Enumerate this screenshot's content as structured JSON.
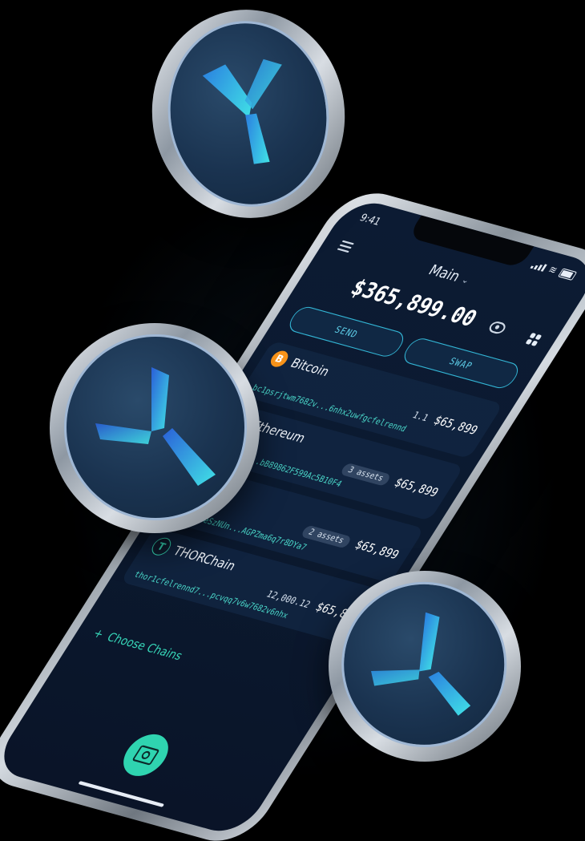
{
  "status_bar": {
    "time": "9:41"
  },
  "header": {
    "vault_name": "Main"
  },
  "portfolio": {
    "balance": "$365,899.00"
  },
  "actions": {
    "send_label": "SEND",
    "swap_label": "SWAP"
  },
  "chains": [
    {
      "name": "Bitcoin",
      "logo": "B",
      "amount": "1.1",
      "value": "$65,899",
      "address": "bc1psrjtwm7682v...6nhx2uwfgcfelrennd",
      "assets": ""
    },
    {
      "name": "Ethereum",
      "logo": "E",
      "amount": "",
      "value": "$65,899",
      "address": "0x0a4242...bB89862F599Ac5B10F4",
      "assets": "3 assets"
    },
    {
      "name": "",
      "logo": "",
      "amount": "",
      "value": "$65,899",
      "address": "...2bKieSzNUn...AGPZma6q7r8DYa7",
      "assets": "2 assets"
    },
    {
      "name": "THORChain",
      "logo": "T",
      "amount": "12,000.12",
      "value": "$65,899",
      "address": "thor1cfelrennd7...pcvqq7v6w7682v6nhx",
      "assets": ""
    }
  ],
  "footer": {
    "choose_chains_label": "Choose Chains",
    "choose_chains_icon": "+"
  },
  "icons": [
    "menu-icon",
    "chevron-down-icon",
    "eye-icon",
    "grid-icon",
    "camera-icon",
    "coin-logo-icon"
  ],
  "colors": {
    "accent": "#36d6b8",
    "button_border": "#33b6d6",
    "btc": "#f7931a",
    "address": "#4ad7c9"
  }
}
